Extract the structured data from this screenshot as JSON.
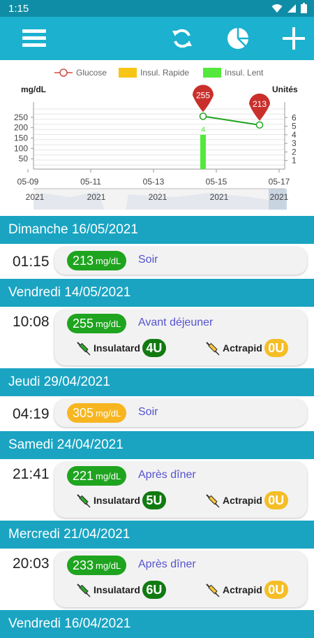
{
  "status": {
    "time": "1:15"
  },
  "toolbar": {
    "menu": "menu-icon",
    "sync": "sync-icon",
    "stats": "pie-chart-icon",
    "add": "plus-icon"
  },
  "chart_data": {
    "type": "line",
    "legend": [
      "Glucose",
      "Insul. Rapide",
      "Insul. Lent"
    ],
    "ylabel_left": "mg/dL",
    "ylabel_right": "Unités",
    "yticks_left": [
      "250",
      "200",
      "150",
      "100",
      "50"
    ],
    "yticks_right": [
      "6",
      "5",
      "4",
      "3",
      "2",
      "1"
    ],
    "x_dates": [
      "05-09",
      "05-11",
      "05-13",
      "05-15",
      "05-17"
    ],
    "nav_years": [
      "2021",
      "2021",
      "2021",
      "2021",
      "2021"
    ],
    "ylim_left": [
      0,
      290
    ],
    "ylim_right": [
      0,
      7
    ],
    "xlim": [
      9,
      17
    ],
    "series": [
      {
        "name": "Glucose",
        "x": [
          14.4,
          16.2
        ],
        "values": [
          255,
          213
        ],
        "labels": [
          "255",
          "213"
        ]
      },
      {
        "name": "Insul. Lent",
        "x": [
          14.4
        ],
        "values": [
          4
        ],
        "label": "4"
      }
    ],
    "colors": {
      "glucose": "#1fa41f",
      "slow": "#54e83c",
      "rapid": "#f7c516",
      "marker": "#c9302c"
    }
  },
  "days": [
    {
      "header": "Dimanche 16/05/2021",
      "entries": [
        {
          "time": "01:15",
          "value": "213",
          "unit": "mg/dL",
          "color": "green",
          "period": "Soir"
        }
      ]
    },
    {
      "header": "Vendredi 14/05/2021",
      "entries": [
        {
          "time": "10:08",
          "value": "255",
          "unit": "mg/dL",
          "color": "green",
          "period": "Avant déjeuner",
          "insulin_slow": {
            "name": "Insulatard",
            "dose": "4U"
          },
          "insulin_rapid": {
            "name": "Actrapid",
            "dose": "0U"
          }
        }
      ]
    },
    {
      "header": "Jeudi 29/04/2021",
      "entries": [
        {
          "time": "04:19",
          "value": "305",
          "unit": "mg/dL",
          "color": "yellow",
          "period": "Soir"
        }
      ]
    },
    {
      "header": "Samedi 24/04/2021",
      "entries": [
        {
          "time": "21:41",
          "value": "221",
          "unit": "mg/dL",
          "color": "green",
          "period": "Après dîner",
          "insulin_slow": {
            "name": "Insulatard",
            "dose": "5U"
          },
          "insulin_rapid": {
            "name": "Actrapid",
            "dose": "0U"
          }
        }
      ]
    },
    {
      "header": "Mercredi 21/04/2021",
      "entries": [
        {
          "time": "20:03",
          "value": "233",
          "unit": "mg/dL",
          "color": "green",
          "period": "Après dîner",
          "insulin_slow": {
            "name": "Insulatard",
            "dose": "6U"
          },
          "insulin_rapid": {
            "name": "Actrapid",
            "dose": "0U"
          }
        }
      ]
    },
    {
      "header": "Vendredi 16/04/2021",
      "entries": []
    }
  ]
}
